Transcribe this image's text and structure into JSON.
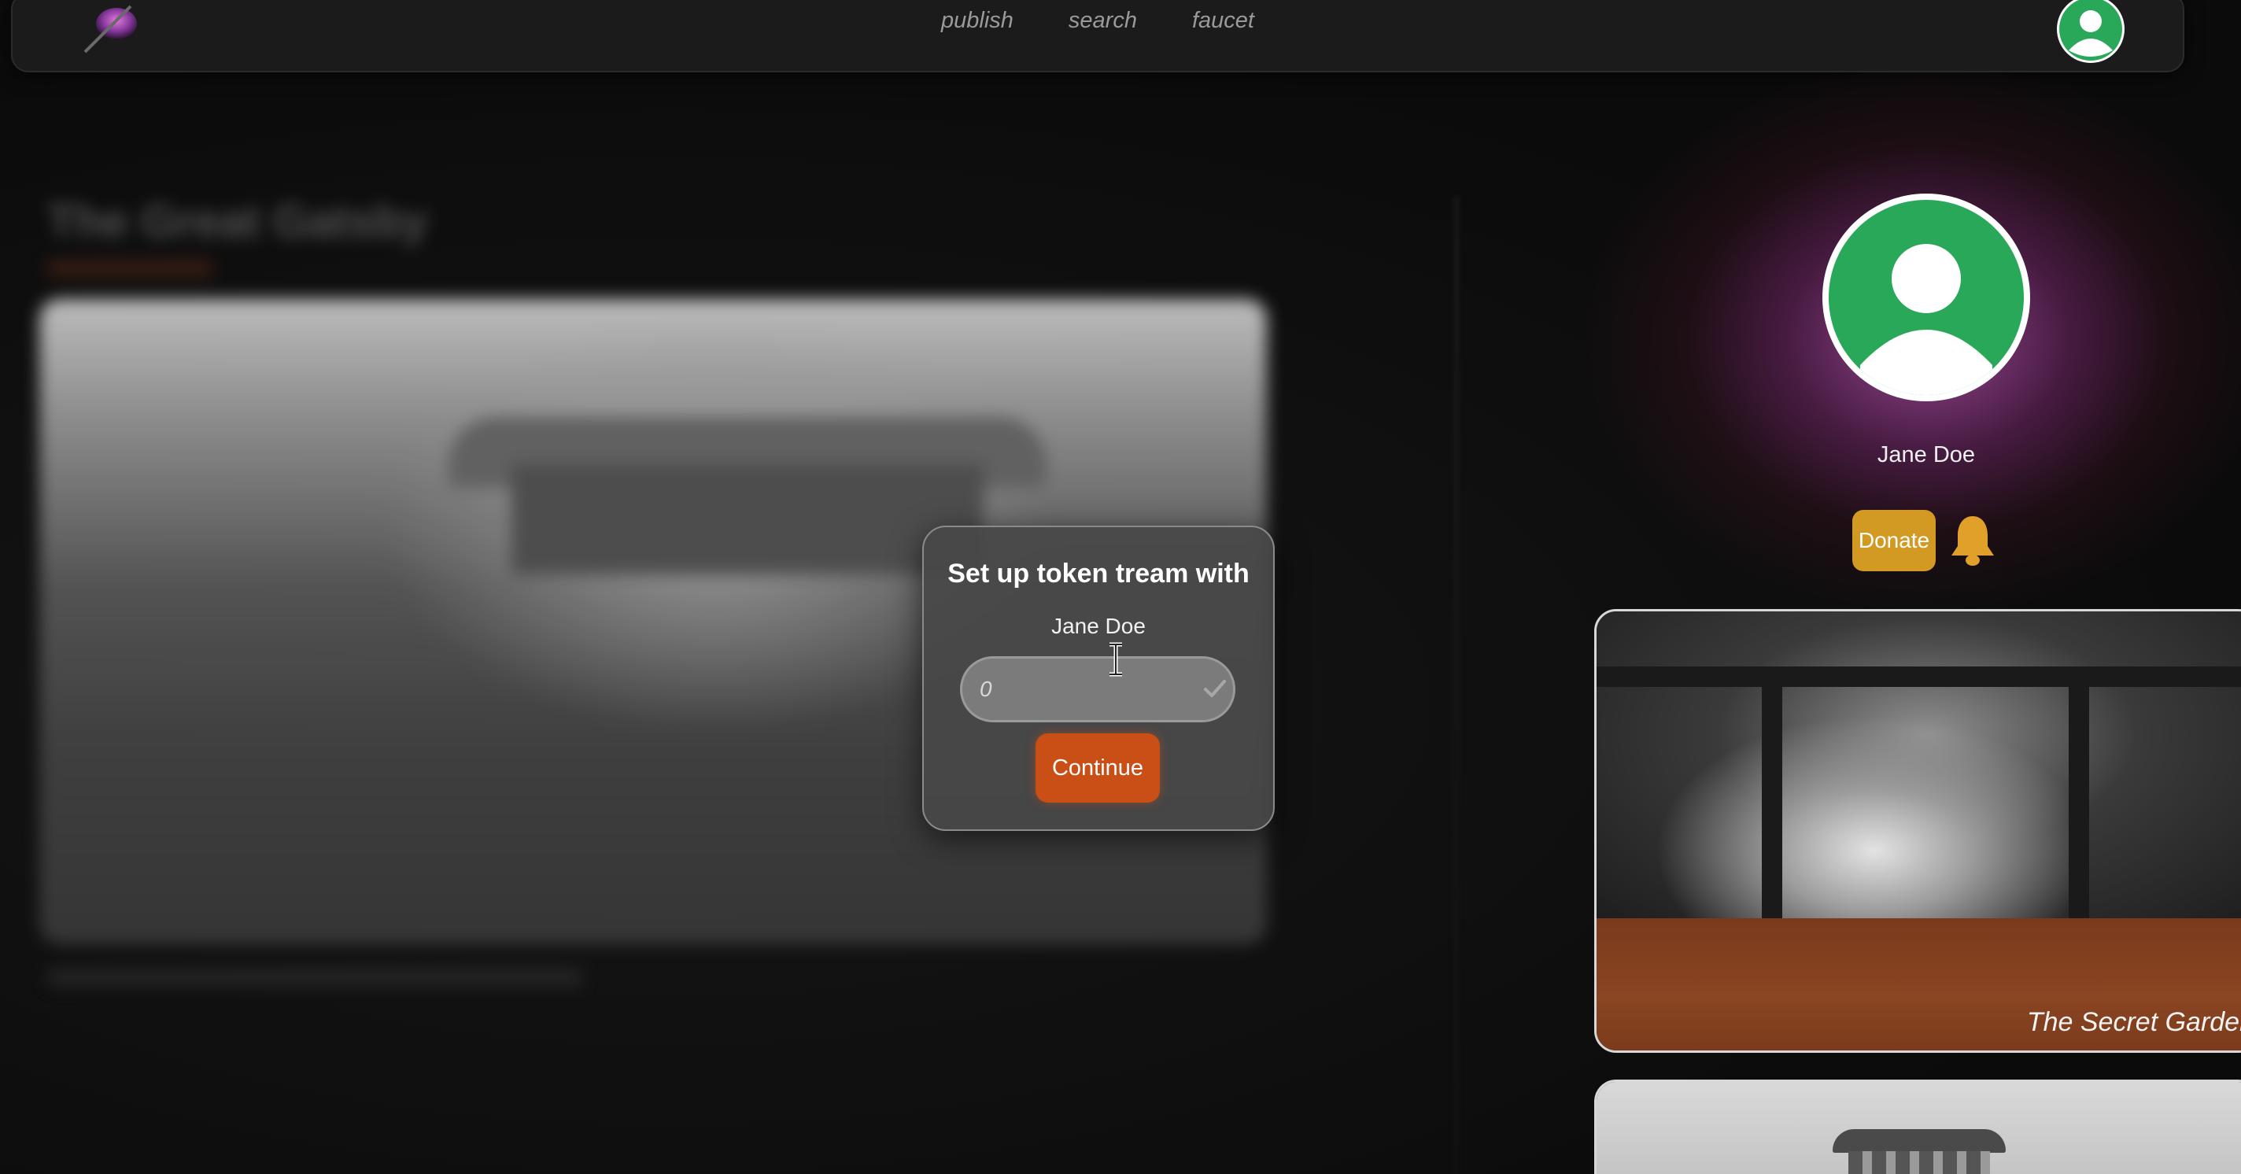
{
  "nav": {
    "links": [
      "publish",
      "search",
      "faucet"
    ]
  },
  "post": {
    "title": "The Great Gatsby"
  },
  "profile": {
    "name": "Jane Doe",
    "donate_label": "Donate"
  },
  "cards": [
    {
      "title": "The Secret Garden"
    },
    {
      "title": ""
    }
  ],
  "modal": {
    "title": "Set up token tream with",
    "recipient": "Jane Doe",
    "amount_placeholder": "0",
    "continue_label": "Continue"
  },
  "colors": {
    "accent_orange": "#c94f16",
    "donate_gold": "#d39a23",
    "avatar_green": "#2aa85a"
  }
}
